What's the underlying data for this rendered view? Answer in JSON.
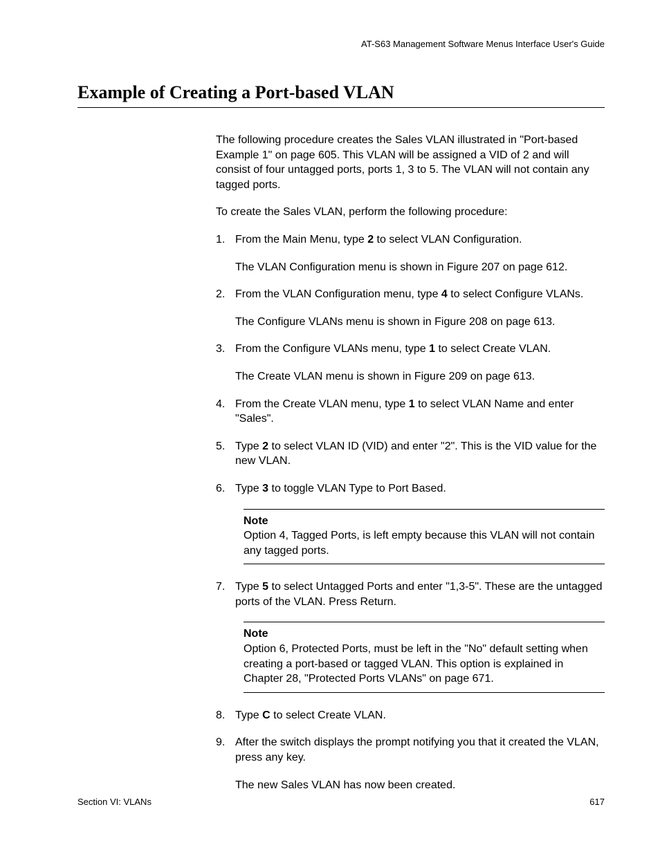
{
  "header": {
    "running": "AT-S63 Management Software Menus Interface User's Guide"
  },
  "title": "Example of Creating a Port-based VLAN",
  "intro": {
    "p1": "The following procedure creates the Sales VLAN illustrated in \"Port-based Example 1\" on page 605. This VLAN will be assigned a VID of 2 and will consist of four untagged ports, ports 1, 3 to 5. The VLAN will not contain any tagged ports.",
    "p2": "To create the Sales VLAN, perform the following procedure:"
  },
  "steps": {
    "s1": {
      "num": "1.",
      "pre": "From the Main Menu, type ",
      "key": "2",
      "post": " to select VLAN Configuration.",
      "result": "The VLAN Configuration menu is shown in Figure 207 on page 612."
    },
    "s2": {
      "num": "2.",
      "pre": "From the VLAN Configuration menu, type ",
      "key": "4",
      "post": " to select Configure VLANs.",
      "result": "The Configure VLANs menu is shown in Figure 208 on page 613."
    },
    "s3": {
      "num": "3.",
      "pre": "From the Configure VLANs menu, type ",
      "key": "1",
      "post": " to select Create VLAN.",
      "result": "The Create VLAN menu is shown in Figure 209 on page 613."
    },
    "s4": {
      "num": "4.",
      "pre": "From the Create VLAN menu, type ",
      "key": "1",
      "post": " to select VLAN Name and enter \"Sales\"."
    },
    "s5": {
      "num": "5.",
      "pre": "Type ",
      "key": "2",
      "post": " to select VLAN ID (VID) and enter \"2\". This is the VID value for the new VLAN."
    },
    "s6": {
      "num": "6.",
      "pre": "Type ",
      "key": "3",
      "post": " to toggle VLAN Type to Port Based."
    },
    "s7": {
      "num": "7.",
      "pre": "Type ",
      "key": "5",
      "post": " to select Untagged Ports and enter \"1,3-5\". These are the untagged ports of the VLAN. Press Return."
    },
    "s8": {
      "num": "8.",
      "pre": "Type ",
      "key": "C",
      "post": " to select Create VLAN."
    },
    "s9": {
      "num": "9.",
      "text": "After the switch displays the prompt notifying you that it created the VLAN, press any key.",
      "result": "The new Sales VLAN has now been created."
    }
  },
  "notes": {
    "label": "Note",
    "n1": "Option 4, Tagged Ports, is left empty because this VLAN will not contain any tagged ports.",
    "n2": "Option 6, Protected Ports, must be left in the \"No\" default setting when creating a port-based or tagged VLAN. This option is explained in Chapter 28, \"Protected Ports VLANs\" on page 671."
  },
  "footer": {
    "section": "Section VI: VLANs",
    "page": "617"
  }
}
